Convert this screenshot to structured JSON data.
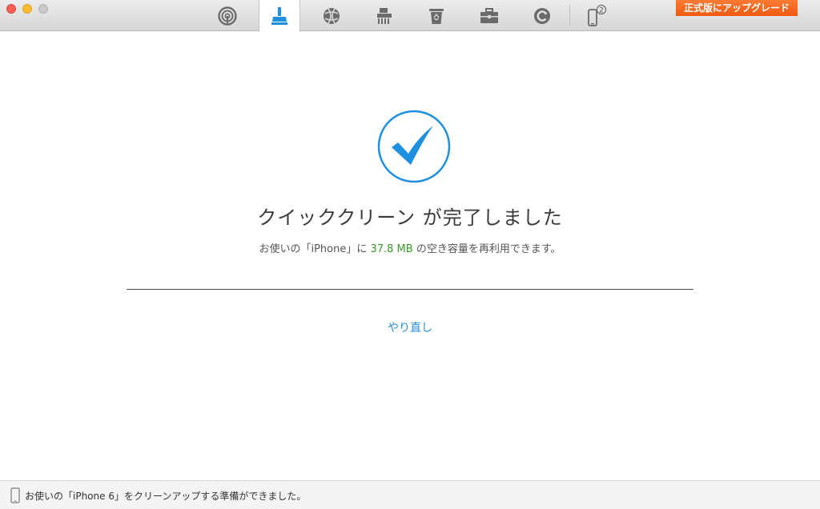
{
  "toolbar": {
    "tools": [
      {
        "name": "privacy-tool",
        "icon": "fingerprint-icon",
        "active": false
      },
      {
        "name": "quick-clean-tool",
        "icon": "broom-icon",
        "active": true
      },
      {
        "name": "internet-clean-tool",
        "icon": "globe-icon",
        "active": false
      },
      {
        "name": "deep-clean-tool",
        "icon": "shredder-icon",
        "active": false
      },
      {
        "name": "trash-tool",
        "icon": "recycle-bin-icon",
        "active": false
      },
      {
        "name": "toolbox-tool",
        "icon": "briefcase-icon",
        "active": false
      },
      {
        "name": "backup-tool",
        "icon": "backup-icon",
        "active": false
      },
      {
        "name": "devices-tool",
        "icon": "phone-count-icon",
        "active": false
      }
    ],
    "device_count": "2",
    "upgrade_label": "正式版にアップグレード"
  },
  "colors": {
    "accent": "#2b8fd8",
    "check_blue": "#1f8fe0",
    "highlight_green": "#3a9a2a",
    "upgrade_orange": "#f26a1f"
  },
  "main": {
    "title": "クイッククリーン が完了しました",
    "subtitle_prefix": "お使いの「iPhone」に ",
    "subtitle_amount": "37.8 MB",
    "subtitle_suffix": " の空き容量を再利用できます。",
    "retry_label": "やり直し"
  },
  "statusbar": {
    "message": "お使いの「iPhone 6」をクリーンアップする準備ができました。"
  }
}
